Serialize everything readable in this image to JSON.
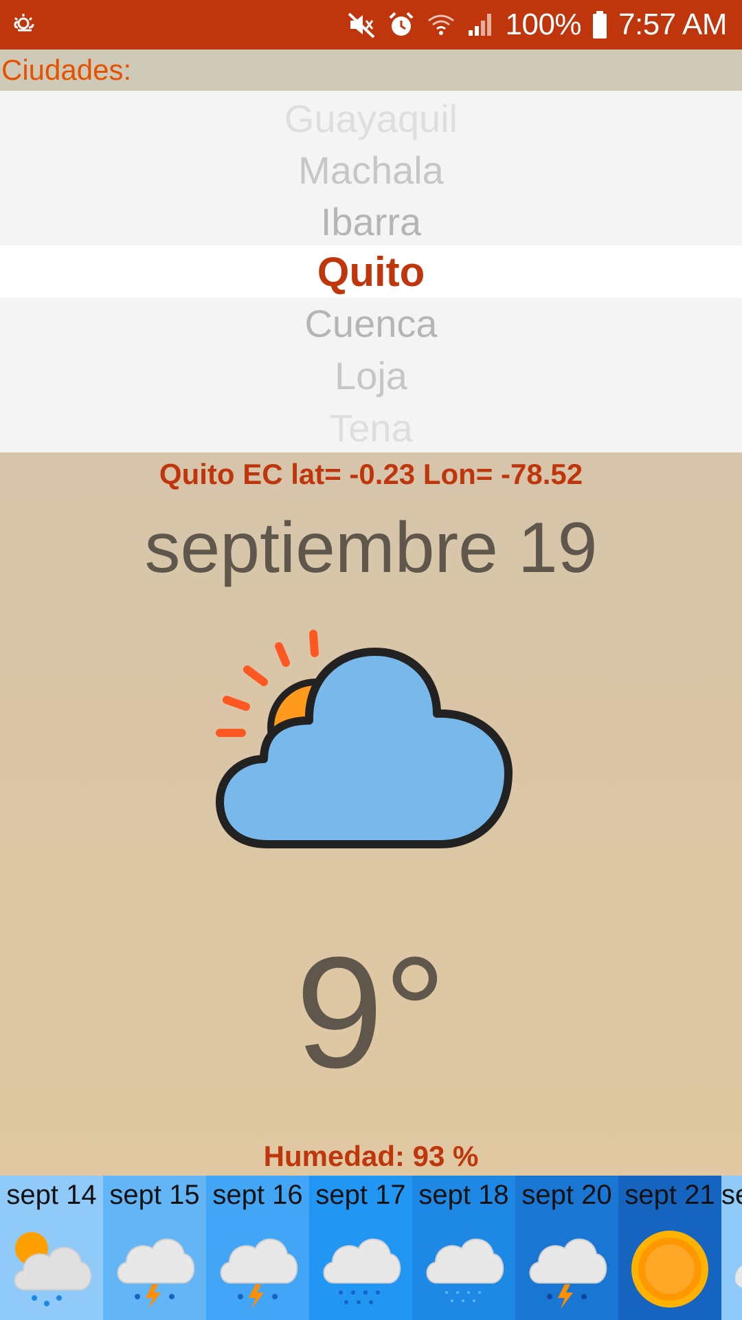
{
  "status_bar": {
    "battery": "100%",
    "time": "7:57 AM"
  },
  "header": {
    "label": "Ciudades:"
  },
  "picker": {
    "items": [
      "Guayaquil",
      "Machala",
      "Ibarra",
      "Quito",
      "Cuenca",
      "Loja",
      "Tena"
    ],
    "selected": "Quito"
  },
  "current": {
    "location": "Quito EC lat= -0.23 Lon= -78.52",
    "date": "septiembre 19",
    "temperature": "9°",
    "humidity": "Humedad: 93 %",
    "icon": "partly-cloudy-icon"
  },
  "forecast": [
    {
      "label": "sept 14",
      "icon": "sun-cloud-rain-icon",
      "bg": "#90caf9"
    },
    {
      "label": "sept 15",
      "icon": "thunder-rain-icon",
      "bg": "#64b5f6"
    },
    {
      "label": "sept 16",
      "icon": "thunder-rain-icon",
      "bg": "#42a5f5"
    },
    {
      "label": "sept 17",
      "icon": "snow-cloud-icon",
      "bg": "#2196f3"
    },
    {
      "label": "sept 18",
      "icon": "drizzle-cloud-icon",
      "bg": "#1e88e5"
    },
    {
      "label": "sept 20",
      "icon": "thunder-rain-icon",
      "bg": "#1976d2"
    },
    {
      "label": "sept 21",
      "icon": "sun-icon",
      "bg": "#1565c0"
    },
    {
      "label": "se",
      "icon": "cloud-icon",
      "bg": "#90caf9"
    }
  ],
  "colors": {
    "accent": "#bf360c",
    "header_text": "#e65100",
    "main_text": "#5f574c"
  }
}
